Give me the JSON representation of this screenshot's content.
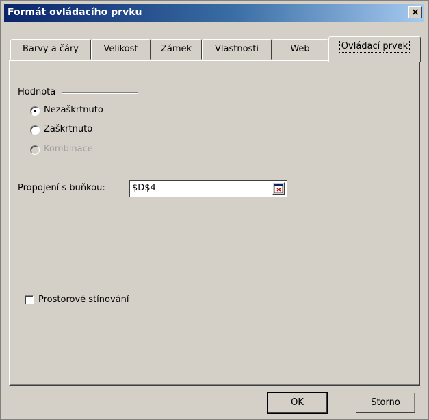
{
  "window": {
    "title": "Formát ovládacího prvku",
    "close_label": "×"
  },
  "tabs": [
    {
      "label": "Barvy a čáry"
    },
    {
      "label": "Velikost"
    },
    {
      "label": "Zámek"
    },
    {
      "label": "Vlastnosti"
    },
    {
      "label": "Web"
    },
    {
      "label": "Ovládací prvek"
    }
  ],
  "active_tab": "Ovládací prvek",
  "value_group": {
    "title": "Hodnota",
    "options": [
      {
        "label": "Nezaškrtnuto",
        "selected": true,
        "enabled": true
      },
      {
        "label": "Zaškrtnuto",
        "selected": false,
        "enabled": true
      },
      {
        "label": "Kombinace",
        "selected": false,
        "enabled": false
      }
    ]
  },
  "cell_link": {
    "label": "Propojení s buňkou:",
    "value": "$D$4"
  },
  "shading": {
    "label": "Prostorové stínování",
    "checked": false
  },
  "buttons": {
    "ok": "OK",
    "cancel": "Storno"
  }
}
